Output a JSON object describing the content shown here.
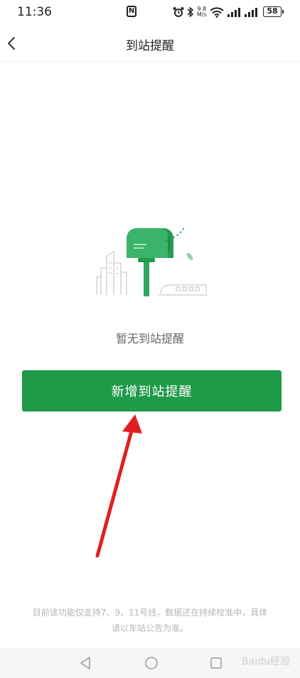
{
  "status_bar": {
    "time": "11:36",
    "nfc_label": "N",
    "net_speed_value": "9.8",
    "net_speed_unit": "M/s",
    "battery": "58"
  },
  "header": {
    "title": "到站提醒",
    "back_icon": "chevron-left-icon"
  },
  "main": {
    "empty_text": "暂无到站提醒",
    "add_button_label": "新增到站提醒",
    "notice_text": "目前该功能仅支持7、9、11号线，数据还在持续校准中，具体请以车站公告为准。"
  },
  "system_nav": {
    "back": "triangle-back-icon",
    "home": "circle-home-icon",
    "recents": "square-recents-icon"
  },
  "watermark": "Baidu经验",
  "colors": {
    "accent": "#1f9a49",
    "annotation_arrow": "#e02020"
  }
}
